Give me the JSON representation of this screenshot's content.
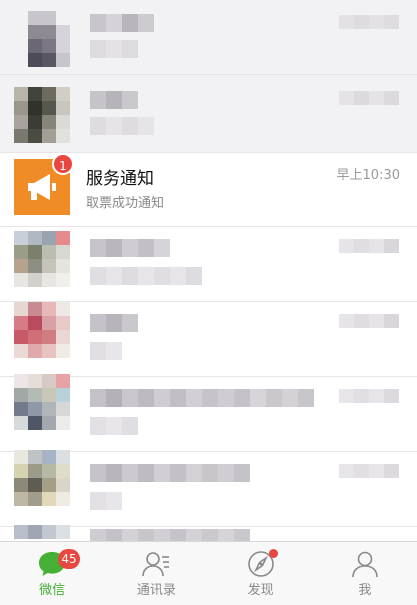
{
  "chat_list": {
    "featured": {
      "title": "服务通知",
      "subtitle": "取票成功通知",
      "time": "早上10:30",
      "unread": "1"
    }
  },
  "tabbar": {
    "items": [
      {
        "label": "微信",
        "badge": "45",
        "icon": "chat-bubble-icon",
        "active": true
      },
      {
        "label": "通讯录",
        "icon": "contacts-icon",
        "active": false
      },
      {
        "label": "发现",
        "icon": "compass-icon",
        "active": false
      },
      {
        "label": "我",
        "icon": "person-icon",
        "active": false
      }
    ]
  },
  "colors": {
    "accent_green": "#45b035",
    "badge_red": "#e8463f",
    "notify_orange": "#f08c25"
  }
}
